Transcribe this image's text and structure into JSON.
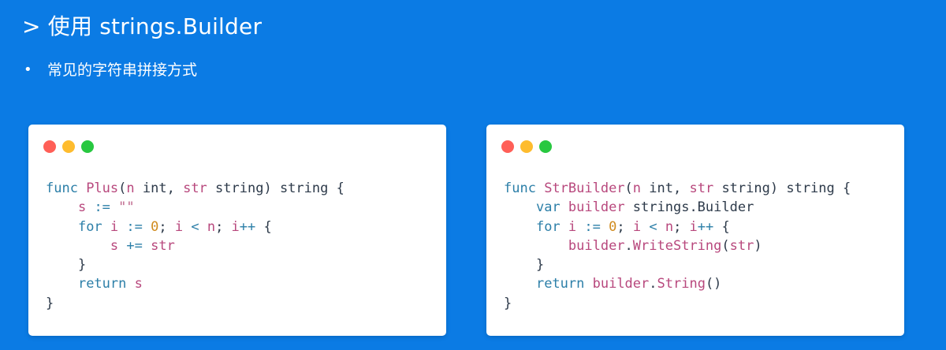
{
  "slide": {
    "title": "> 使用 strings.Builder",
    "bullet_marker": "•",
    "bullet_text": "常见的字符串拼接方式"
  },
  "cards": [
    {
      "name": "plus-code-card",
      "lines": [
        [
          [
            "kw",
            "func "
          ],
          [
            "fn",
            "Plus"
          ],
          [
            "punc",
            "("
          ],
          [
            "param",
            "n "
          ],
          [
            "type",
            "int"
          ],
          [
            "punc",
            ", "
          ],
          [
            "param",
            "str "
          ],
          [
            "type",
            "string"
          ],
          [
            "punc",
            ") "
          ],
          [
            "type",
            "string"
          ],
          [
            "punc",
            " {"
          ]
        ],
        [
          [
            "punc",
            "    "
          ],
          [
            "param",
            "s"
          ],
          [
            "op",
            " := "
          ],
          [
            "str",
            "\"\""
          ]
        ],
        [
          [
            "punc",
            "    "
          ],
          [
            "kw",
            "for "
          ],
          [
            "param",
            "i"
          ],
          [
            "op",
            " := "
          ],
          [
            "num",
            "0"
          ],
          [
            "punc",
            "; "
          ],
          [
            "param",
            "i"
          ],
          [
            "op",
            " < "
          ],
          [
            "param",
            "n"
          ],
          [
            "punc",
            "; "
          ],
          [
            "param",
            "i"
          ],
          [
            "op",
            "++"
          ],
          [
            "punc",
            " {"
          ]
        ],
        [
          [
            "punc",
            "        "
          ],
          [
            "param",
            "s"
          ],
          [
            "op",
            " += "
          ],
          [
            "param",
            "str"
          ]
        ],
        [
          [
            "punc",
            "    }"
          ]
        ],
        [
          [
            "punc",
            "    "
          ],
          [
            "kw",
            "return "
          ],
          [
            "param",
            "s"
          ]
        ],
        [
          [
            "punc",
            "}"
          ]
        ]
      ]
    },
    {
      "name": "strbuilder-code-card",
      "lines": [
        [
          [
            "kw",
            "func "
          ],
          [
            "fn",
            "StrBuilder"
          ],
          [
            "punc",
            "("
          ],
          [
            "param",
            "n "
          ],
          [
            "type",
            "int"
          ],
          [
            "punc",
            ", "
          ],
          [
            "param",
            "str "
          ],
          [
            "type",
            "string"
          ],
          [
            "punc",
            ") "
          ],
          [
            "type",
            "string"
          ],
          [
            "punc",
            " {"
          ]
        ],
        [
          [
            "punc",
            "    "
          ],
          [
            "kw",
            "var "
          ],
          [
            "param",
            "builder "
          ],
          [
            "type",
            "strings.Builder"
          ]
        ],
        [
          [
            "punc",
            "    "
          ],
          [
            "kw",
            "for "
          ],
          [
            "param",
            "i"
          ],
          [
            "op",
            " := "
          ],
          [
            "num",
            "0"
          ],
          [
            "punc",
            "; "
          ],
          [
            "param",
            "i"
          ],
          [
            "op",
            " < "
          ],
          [
            "param",
            "n"
          ],
          [
            "punc",
            "; "
          ],
          [
            "param",
            "i"
          ],
          [
            "op",
            "++"
          ],
          [
            "punc",
            " {"
          ]
        ],
        [
          [
            "punc",
            "        "
          ],
          [
            "param",
            "builder"
          ],
          [
            "punc",
            "."
          ],
          [
            "fn",
            "WriteString"
          ],
          [
            "punc",
            "("
          ],
          [
            "param",
            "str"
          ],
          [
            "punc",
            ")"
          ]
        ],
        [
          [
            "punc",
            "    }"
          ]
        ],
        [
          [
            "punc",
            "    "
          ],
          [
            "kw",
            "return "
          ],
          [
            "param",
            "builder"
          ],
          [
            "punc",
            "."
          ],
          [
            "fn",
            "String"
          ],
          [
            "punc",
            "()"
          ]
        ],
        [
          [
            "punc",
            "}"
          ]
        ]
      ]
    }
  ]
}
